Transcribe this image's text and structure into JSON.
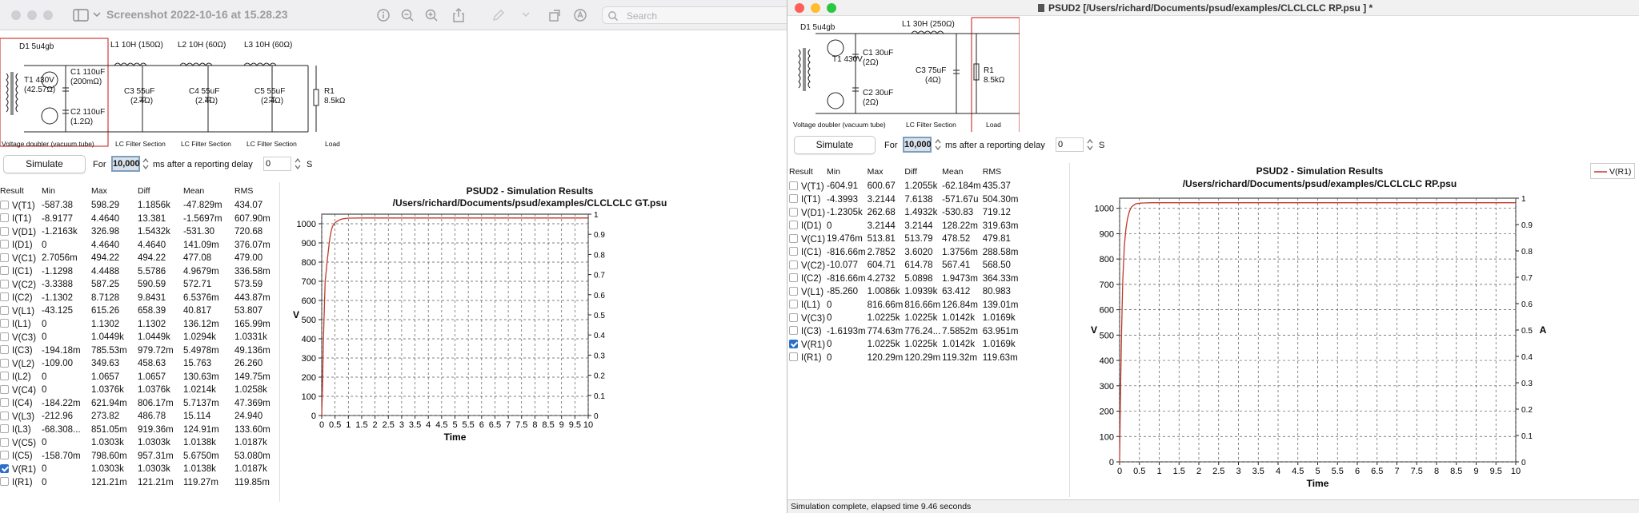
{
  "left_window": {
    "title": "Screenshot 2022-10-16 at 15.28.23",
    "search_placeholder": "Search",
    "circuit": {
      "transformer": "D1 5u4gb",
      "t1_label": "T1 430V",
      "t1_res": "(42.57Ω)",
      "c1": "C1 110uF",
      "c1_res": "(200mΩ)",
      "c2": "C2 110uF",
      "c2_res": "(1.2Ω)",
      "l1": "L1 10H (150Ω)",
      "l2": "L2 10H (60Ω)",
      "l3": "L3 10H (60Ω)",
      "c3": "C3 55uF",
      "c3_res": "(2.4Ω)",
      "c4": "C4 55uF",
      "c4_res": "(2.4Ω)",
      "c5": "C5 55uF",
      "c5_res": "(2.4Ω)",
      "r1": "R1",
      "r1_val": "8.5kΩ",
      "sections": [
        "Voltage doubler (vacuum tube)",
        "LC Filter Section",
        "LC Filter Section",
        "LC Filter Section",
        "Load"
      ]
    },
    "controls": {
      "simulate": "Simulate",
      "for": "For",
      "ms_value": "10,000",
      "ms_after": "ms  after a reporting delay",
      "delay": "0",
      "s": "S"
    },
    "columns": [
      "Result",
      "Min",
      "Max",
      "Diff",
      "Mean",
      "RMS"
    ],
    "rows": [
      {
        "name": "V(T1)",
        "min": "-587.38",
        "max": "598.29",
        "diff": "1.1856k",
        "mean": "-47.829m",
        "rms": "434.07",
        "checked": false
      },
      {
        "name": "I(T1)",
        "min": "-8.9177",
        "max": "4.4640",
        "diff": "13.381",
        "mean": "-1.5697m",
        "rms": "607.90m",
        "checked": false
      },
      {
        "name": "V(D1)",
        "min": "-1.2163k",
        "max": "326.98",
        "diff": "1.5432k",
        "mean": "-531.30",
        "rms": "720.68",
        "checked": false
      },
      {
        "name": "I(D1)",
        "min": "0",
        "max": "4.4640",
        "diff": "4.4640",
        "mean": "141.09m",
        "rms": "376.07m",
        "checked": false
      },
      {
        "name": "V(C1)",
        "min": "2.7056m",
        "max": "494.22",
        "diff": "494.22",
        "mean": "477.08",
        "rms": "479.00",
        "checked": false
      },
      {
        "name": "I(C1)",
        "min": "-1.1298",
        "max": "4.4488",
        "diff": "5.5786",
        "mean": "4.9679m",
        "rms": "336.58m",
        "checked": false
      },
      {
        "name": "V(C2)",
        "min": "-3.3388",
        "max": "587.25",
        "diff": "590.59",
        "mean": "572.71",
        "rms": "573.59",
        "checked": false
      },
      {
        "name": "I(C2)",
        "min": "-1.1302",
        "max": "8.7128",
        "diff": "9.8431",
        "mean": "6.5376m",
        "rms": "443.87m",
        "checked": false
      },
      {
        "name": "V(L1)",
        "min": "-43.125",
        "max": "615.26",
        "diff": "658.39",
        "mean": "40.817",
        "rms": "53.807",
        "checked": false
      },
      {
        "name": "I(L1)",
        "min": "0",
        "max": "1.1302",
        "diff": "1.1302",
        "mean": "136.12m",
        "rms": "165.99m",
        "checked": false
      },
      {
        "name": "V(C3)",
        "min": "0",
        "max": "1.0449k",
        "diff": "1.0449k",
        "mean": "1.0294k",
        "rms": "1.0331k",
        "checked": false
      },
      {
        "name": "I(C3)",
        "min": "-194.18m",
        "max": "785.53m",
        "diff": "979.72m",
        "mean": "5.4978m",
        "rms": "49.136m",
        "checked": false
      },
      {
        "name": "V(L2)",
        "min": "-109.00",
        "max": "349.63",
        "diff": "458.63",
        "mean": "15.763",
        "rms": "26.260",
        "checked": false
      },
      {
        "name": "I(L2)",
        "min": "0",
        "max": "1.0657",
        "diff": "1.0657",
        "mean": "130.63m",
        "rms": "149.75m",
        "checked": false
      },
      {
        "name": "V(C4)",
        "min": "0",
        "max": "1.0376k",
        "diff": "1.0376k",
        "mean": "1.0214k",
        "rms": "1.0258k",
        "checked": false
      },
      {
        "name": "I(C4)",
        "min": "-184.22m",
        "max": "621.94m",
        "diff": "806.17m",
        "mean": "5.7137m",
        "rms": "47.369m",
        "checked": false
      },
      {
        "name": "V(L3)",
        "min": "-212.96",
        "max": "273.82",
        "diff": "486.78",
        "mean": "15.114",
        "rms": "24.940",
        "checked": false
      },
      {
        "name": "I(L3)",
        "min": "-68.308...",
        "max": "851.05m",
        "diff": "919.36m",
        "mean": "124.91m",
        "rms": "133.60m",
        "checked": false
      },
      {
        "name": "V(C5)",
        "min": "0",
        "max": "1.0303k",
        "diff": "1.0303k",
        "mean": "1.0138k",
        "rms": "1.0187k",
        "checked": false
      },
      {
        "name": "I(C5)",
        "min": "-158.70m",
        "max": "798.60m",
        "diff": "957.31m",
        "mean": "5.6750m",
        "rms": "53.080m",
        "checked": false
      },
      {
        "name": "V(R1)",
        "min": "0",
        "max": "1.0303k",
        "diff": "1.0303k",
        "mean": "1.0138k",
        "rms": "1.0187k",
        "checked": true
      },
      {
        "name": "I(R1)",
        "min": "0",
        "max": "121.21m",
        "diff": "121.21m",
        "mean": "119.27m",
        "rms": "119.85m",
        "checked": false
      }
    ],
    "chart_title1": "PSUD2 - Simulation Results",
    "chart_title2": "/Users/richard/Documents/psud/examples/CLCLCLC GT.psu"
  },
  "right_window": {
    "title": "PSUD2  [/Users/richard/Documents/psud/examples/CLCLCLC RP.psu ] *",
    "circuit": {
      "transformer": "D1 5u4gb",
      "t1_label": "T1 430V",
      "c1": "C1 30uF",
      "c1_res": "(2Ω)",
      "c2": "C2 30uF",
      "c2_res": "(2Ω)",
      "l1": "L1 30H (250Ω)",
      "c3": "C3 75uF",
      "c3_res": "(4Ω)",
      "r1": "R1",
      "r1_val": "8.5kΩ",
      "sections": [
        "Voltage doubler (vacuum tube)",
        "LC Filter Section",
        "Load"
      ]
    },
    "controls": {
      "simulate": "Simulate",
      "for": "For",
      "ms_value": "10,000",
      "ms_after": "ms  after a reporting delay",
      "delay": "0",
      "s": "S"
    },
    "columns": [
      "Result",
      "Min",
      "Max",
      "Diff",
      "Mean",
      "RMS"
    ],
    "rows": [
      {
        "name": "V(T1)",
        "min": "-604.91",
        "max": "600.67",
        "diff": "1.2055k",
        "mean": "-62.184m",
        "rms": "435.37",
        "checked": false
      },
      {
        "name": "I(T1)",
        "min": "-4.3993",
        "max": "3.2144",
        "diff": "7.6138",
        "mean": "-571.67u",
        "rms": "504.30m",
        "checked": false
      },
      {
        "name": "V(D1)",
        "min": "-1.2305k",
        "max": "262.68",
        "diff": "1.4932k",
        "mean": "-530.83",
        "rms": "719.12",
        "checked": false
      },
      {
        "name": "I(D1)",
        "min": "0",
        "max": "3.2144",
        "diff": "3.2144",
        "mean": "128.22m",
        "rms": "319.63m",
        "checked": false
      },
      {
        "name": "V(C1)",
        "min": "19.476m",
        "max": "513.81",
        "diff": "513.79",
        "mean": "478.52",
        "rms": "479.81",
        "checked": false
      },
      {
        "name": "I(C1)",
        "min": "-816.66m",
        "max": "2.7852",
        "diff": "3.6020",
        "mean": "1.3756m",
        "rms": "288.58m",
        "checked": false
      },
      {
        "name": "V(C2)",
        "min": "-10.077",
        "max": "604.71",
        "diff": "614.78",
        "mean": "567.41",
        "rms": "568.50",
        "checked": false
      },
      {
        "name": "I(C2)",
        "min": "-816.66m",
        "max": "4.2732",
        "diff": "5.0898",
        "mean": "1.9473m",
        "rms": "364.33m",
        "checked": false
      },
      {
        "name": "V(L1)",
        "min": "-85.260",
        "max": "1.0086k",
        "diff": "1.0939k",
        "mean": "63.412",
        "rms": "80.983",
        "checked": false
      },
      {
        "name": "I(L1)",
        "min": "0",
        "max": "816.66m",
        "diff": "816.66m",
        "mean": "126.84m",
        "rms": "139.01m",
        "checked": false
      },
      {
        "name": "V(C3)",
        "min": "0",
        "max": "1.0225k",
        "diff": "1.0225k",
        "mean": "1.0142k",
        "rms": "1.0169k",
        "checked": false
      },
      {
        "name": "I(C3)",
        "min": "-1.6193m",
        "max": "774.63m",
        "diff": "776.24...",
        "mean": "7.5852m",
        "rms": "63.951m",
        "checked": false
      },
      {
        "name": "V(R1)",
        "min": "0",
        "max": "1.0225k",
        "diff": "1.0225k",
        "mean": "1.0142k",
        "rms": "1.0169k",
        "checked": true
      },
      {
        "name": "I(R1)",
        "min": "0",
        "max": "120.29m",
        "diff": "120.29m",
        "mean": "119.32m",
        "rms": "119.63m",
        "checked": false
      }
    ],
    "chart_title1": "PSUD2 - Simulation Results",
    "chart_title2": "/Users/richard/Documents/psud/examples/CLCLCLC RP.psu",
    "legend": "V(R1)",
    "status": "Simulation complete, elapsed time 9.46 seconds",
    "behind_text": "Screenshot 2022-10-16 at 15.28.23"
  },
  "chart_data": [
    {
      "type": "line",
      "title": "PSUD2 - Simulation Results",
      "subtitle": "/Users/richard/Documents/psud/examples/CLCLCLC GT.psu",
      "xlabel": "Time",
      "ylabel": "V",
      "xlim": [
        0,
        10
      ],
      "ylim": [
        0,
        1050
      ],
      "y2lim": [
        0,
        1
      ],
      "x_ticks": [
        "0",
        "0.5",
        "1",
        "1.5",
        "2",
        "2.5",
        "3",
        "3.5",
        "4",
        "4.5",
        "5",
        "5.5",
        "6",
        "6.5",
        "7",
        "7.5",
        "8",
        "8.5",
        "9",
        "9.5",
        "10"
      ],
      "y_ticks": [
        "0",
        "100",
        "200",
        "300",
        "400",
        "500",
        "600",
        "700",
        "800",
        "900",
        "1000"
      ],
      "y2_ticks": [
        "0",
        "0.1",
        "0.2",
        "0.3",
        "0.4",
        "0.5",
        "0.6",
        "0.7",
        "0.8",
        "0.9",
        "1"
      ],
      "grid": true,
      "series": [
        {
          "name": "V(R1)",
          "color": "#c0392b",
          "x": [
            0,
            0.03,
            0.06,
            0.1,
            0.13,
            0.16,
            0.2,
            0.25,
            0.3,
            0.35,
            0.4,
            0.5,
            0.6,
            0.7,
            0.8,
            1,
            1.5,
            2,
            3,
            4,
            5,
            6,
            7,
            8,
            9,
            10
          ],
          "y": [
            0,
            150,
            380,
            560,
            700,
            740,
            800,
            860,
            920,
            960,
            985,
            1005,
            1015,
            1022,
            1026,
            1029,
            1030,
            1030,
            1030,
            1030,
            1030,
            1030,
            1030,
            1030,
            1030,
            1030
          ]
        }
      ]
    },
    {
      "type": "line",
      "title": "PSUD2 - Simulation Results",
      "subtitle": "/Users/richard/Documents/psud/examples/CLCLCLC RP.psu",
      "xlabel": "Time",
      "ylabel": "V",
      "y2label": "A",
      "xlim": [
        0,
        10
      ],
      "ylim": [
        0,
        1040
      ],
      "y2lim": [
        0,
        1
      ],
      "x_ticks": [
        "0",
        "0.5",
        "1",
        "1.5",
        "2",
        "2.5",
        "3",
        "3.5",
        "4",
        "4.5",
        "5",
        "5.5",
        "6",
        "6.5",
        "7",
        "7.5",
        "8",
        "8.5",
        "9",
        "9.5",
        "10"
      ],
      "y_ticks": [
        "0",
        "100",
        "200",
        "300",
        "400",
        "500",
        "600",
        "700",
        "800",
        "900",
        "1000"
      ],
      "y2_ticks": [
        "0",
        "0.1",
        "0.2",
        "0.3",
        "0.4",
        "0.5",
        "0.6",
        "0.7",
        "0.8",
        "0.9",
        "1"
      ],
      "grid": true,
      "legend": "top-right",
      "series": [
        {
          "name": "V(R1)",
          "color": "#c0392b",
          "x": [
            0,
            0.02,
            0.05,
            0.08,
            0.12,
            0.16,
            0.2,
            0.25,
            0.3,
            0.35,
            0.4,
            0.5,
            0.6,
            0.8,
            1,
            2,
            3,
            4,
            5,
            6,
            7,
            8,
            9,
            10
          ],
          "y": [
            0,
            250,
            520,
            720,
            850,
            920,
            960,
            990,
            1005,
            1012,
            1017,
            1020,
            1021,
            1022,
            1022,
            1022,
            1022,
            1022,
            1022,
            1022,
            1022,
            1022,
            1022,
            1022
          ]
        }
      ]
    }
  ]
}
